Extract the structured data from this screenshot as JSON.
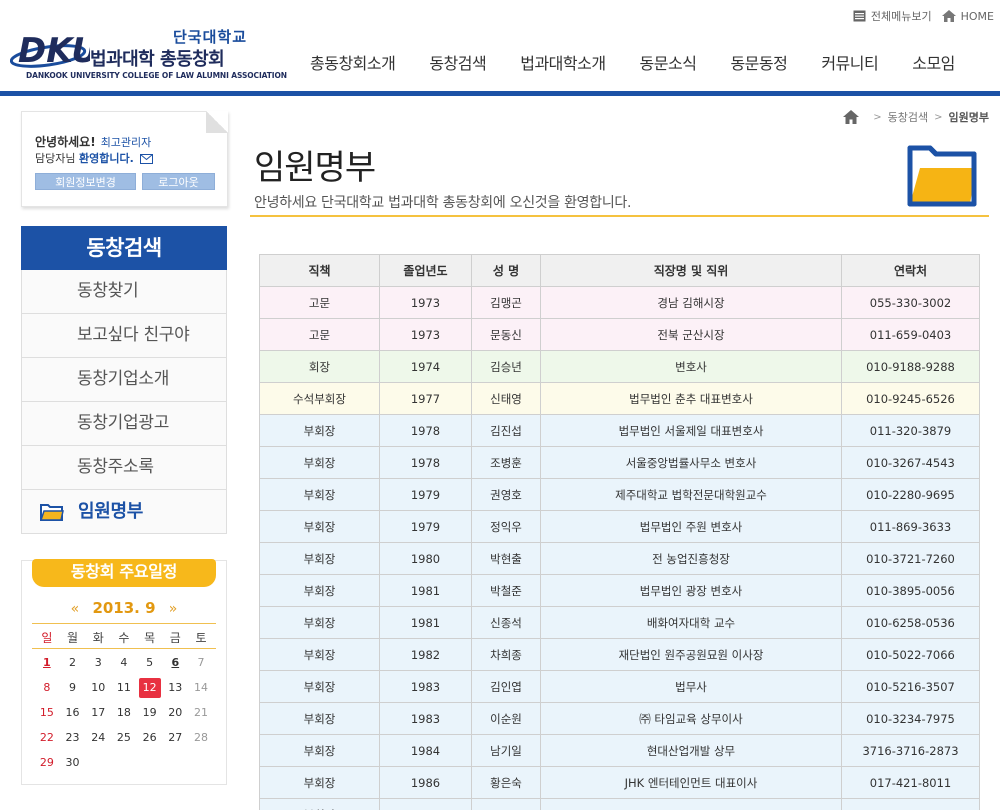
{
  "header": {
    "logo_mark": "DKU",
    "logo_ko_small": "단국대학교",
    "logo_ko_big": "법과대학 총동창회",
    "logo_en": "DANKOOK UNIVERSITY COLLEGE OF LAW ALUMNI ASSOCIATION",
    "util": {
      "sitemap": "전체메뉴보기",
      "home": "HOME"
    },
    "nav": [
      "총동창회소개",
      "동창검색",
      "법과대학소개",
      "동문소식",
      "동문동정",
      "커뮤니티",
      "소모임"
    ],
    "accent_color": "#1c52a6"
  },
  "login": {
    "greeting": "안녕하세요!",
    "user": "최고관리자",
    "line2_prefix": "담당자님",
    "line2_welcome": "환영합니다.",
    "edit_btn": "회원정보변경",
    "logout_btn": "로그아웃"
  },
  "lnb": {
    "title": "동창검색",
    "items": [
      "동창찾기",
      "보고싶다 친구야",
      "동창기업소개",
      "동창기업광고",
      "동창주소록",
      "임원명부"
    ]
  },
  "schedule": {
    "title": "동창회 주요일정",
    "prev": "«",
    "next": "»",
    "month": "2013. 9",
    "weekdays": [
      "일",
      "월",
      "화",
      "수",
      "목",
      "금",
      "토"
    ],
    "weeks": [
      [
        "1",
        "2",
        "3",
        "4",
        "5",
        "6",
        "7"
      ],
      [
        "8",
        "9",
        "10",
        "11",
        "12",
        "13",
        "14"
      ],
      [
        "15",
        "16",
        "17",
        "18",
        "19",
        "20",
        "21"
      ],
      [
        "22",
        "23",
        "24",
        "25",
        "26",
        "27",
        "28"
      ],
      [
        "29",
        "30",
        "",
        "",
        "",
        "",
        ""
      ]
    ],
    "bold_days": [
      "1",
      "6"
    ],
    "today": "12"
  },
  "breadcrumb": [
    "동창검색",
    "임원명부"
  ],
  "page": {
    "title": "임원명부",
    "subtitle": "안녕하세요 단국대학교 법과대학 총동창회에 오신것을 환영합니다."
  },
  "table": {
    "headers": [
      "직책",
      "졸업년도",
      "성 명",
      "직장명 및 직위",
      "연락처"
    ],
    "rows": [
      {
        "tone": "pink",
        "cells": [
          "고문",
          "1973",
          "김맹곤",
          "경남 김해시장",
          "055-330-3002"
        ]
      },
      {
        "tone": "pink",
        "cells": [
          "고문",
          "1973",
          "문동신",
          "전북 군산시장",
          "011-659-0403"
        ]
      },
      {
        "tone": "green",
        "cells": [
          "회장",
          "1974",
          "김승년",
          "변호사",
          "010-9188-9288"
        ]
      },
      {
        "tone": "yellow",
        "cells": [
          "수석부회장",
          "1977",
          "신태영",
          "법무법인 춘추 대표변호사",
          "010-9245-6526"
        ]
      },
      {
        "tone": "blue",
        "cells": [
          "부회장",
          "1978",
          "김진섭",
          "법무법인 서울제일 대표변호사",
          "011-320-3879"
        ]
      },
      {
        "tone": "blue",
        "cells": [
          "부회장",
          "1978",
          "조병훈",
          "서울중앙법률사무소 변호사",
          "010-3267-4543"
        ]
      },
      {
        "tone": "blue",
        "cells": [
          "부회장",
          "1979",
          "권영호",
          "제주대학교 법학전문대학원교수",
          "010-2280-9695"
        ]
      },
      {
        "tone": "blue",
        "cells": [
          "부회장",
          "1979",
          "정익우",
          "법무법인 주원 변호사",
          "011-869-3633"
        ]
      },
      {
        "tone": "blue",
        "cells": [
          "부회장",
          "1980",
          "박현출",
          "전 농업진흥청장",
          "010-3721-7260"
        ]
      },
      {
        "tone": "blue",
        "cells": [
          "부회장",
          "1981",
          "박철준",
          "법무법인 광장 변호사",
          "010-3895-0056"
        ]
      },
      {
        "tone": "blue",
        "cells": [
          "부회장",
          "1981",
          "신종석",
          "배화여자대학 교수",
          "010-6258-0536"
        ]
      },
      {
        "tone": "blue",
        "cells": [
          "부회장",
          "1982",
          "차희종",
          "재단법인 원주공원묘원 이사장",
          "010-5022-7066"
        ]
      },
      {
        "tone": "blue",
        "cells": [
          "부회장",
          "1983",
          "김인엽",
          "법무사",
          "010-5216-3507"
        ]
      },
      {
        "tone": "blue",
        "cells": [
          "부회장",
          "1983",
          "이순원",
          "㈜ 타임교육 상무이사",
          "010-3234-7975"
        ]
      },
      {
        "tone": "blue",
        "cells": [
          "부회장",
          "1984",
          "남기일",
          "현대산업개발 상무",
          "3716-3716-2873"
        ]
      },
      {
        "tone": "blue",
        "cells": [
          "부회장",
          "1986",
          "황은숙",
          "JHK 엔터테인먼트 대표이사",
          "017-421-8011"
        ]
      },
      {
        "tone": "blue",
        "cells": [
          "부회장",
          "",
          "",
          "",
          ""
        ]
      }
    ]
  }
}
